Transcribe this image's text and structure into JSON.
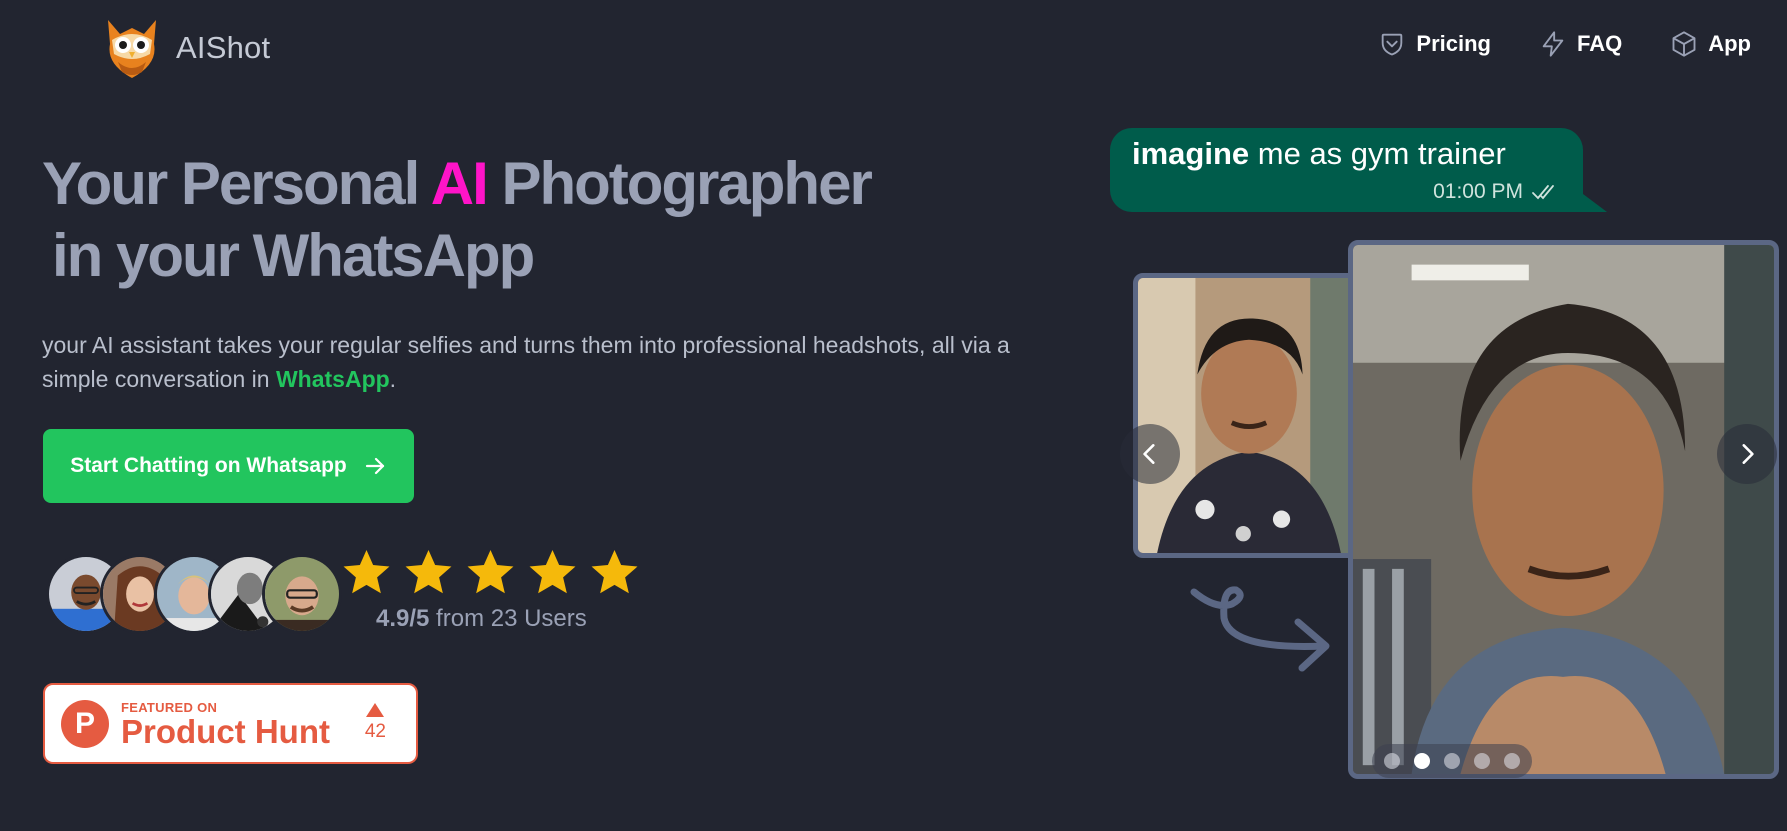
{
  "brand": {
    "name": "AIShot",
    "logo_icon": "owl-logo-icon"
  },
  "nav": {
    "items": [
      {
        "label": "Pricing",
        "icon": "tag-icon"
      },
      {
        "label": "FAQ",
        "icon": "lightning-icon"
      },
      {
        "label": "App",
        "icon": "cube-icon"
      }
    ]
  },
  "hero": {
    "title_part1": "Your Personal ",
    "title_ai": "AI",
    "title_part2": " Photographer",
    "title_line2": "in your WhatsApp",
    "subtitle_part1": "your AI assistant takes your regular selfies and turns them into professional headshots, all via a simple conversation in ",
    "subtitle_whatsapp": "WhatsApp",
    "subtitle_end": ".",
    "accent_color": "#ff14c8",
    "whatsapp_color": "#22c55e"
  },
  "cta": {
    "label": "Start Chatting on Whatsapp",
    "icon": "arrow-right-icon"
  },
  "social_proof": {
    "avatar_count": 5,
    "stars": 5,
    "rating": "4.9/5",
    "rating_suffix": " from 23 Users"
  },
  "product_hunt": {
    "featured": "FEATURED ON",
    "name": "Product Hunt",
    "votes": "42",
    "brand_color": "#e55b41"
  },
  "chat": {
    "message_bold": "imagine",
    "message_rest": " me as gym trainer",
    "time": "01:00 PM",
    "bubble_color": "#005c4b"
  },
  "carousel": {
    "slides": 5,
    "active_index": 1
  }
}
